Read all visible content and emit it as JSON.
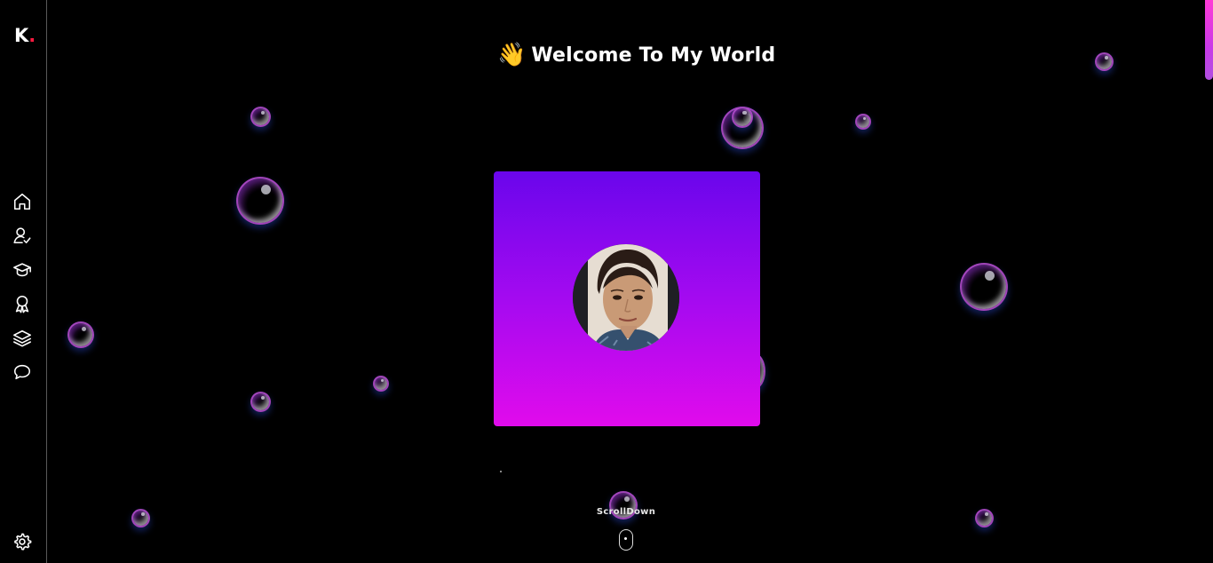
{
  "brand": {
    "logo_letter": "K",
    "logo_dot": ".",
    "accent_color": "#ff1a40"
  },
  "sidebar": {
    "items": [
      {
        "icon": "home-icon",
        "name": "nav-home"
      },
      {
        "icon": "user-check-icon",
        "name": "nav-about"
      },
      {
        "icon": "graduation-cap-icon",
        "name": "nav-education"
      },
      {
        "icon": "award-icon",
        "name": "nav-achievements"
      },
      {
        "icon": "layers-icon",
        "name": "nav-projects"
      },
      {
        "icon": "chat-bubble-icon",
        "name": "nav-contact"
      }
    ],
    "settings_icon": "gear-icon"
  },
  "hero": {
    "wave_emoji": "👋",
    "title": "Welcome To My World",
    "card_gradient": [
      "#6a06ec",
      "#e10bec"
    ]
  },
  "scroll": {
    "label": "ScrollDown"
  },
  "scrollbar_color": "#ff3bd6"
}
